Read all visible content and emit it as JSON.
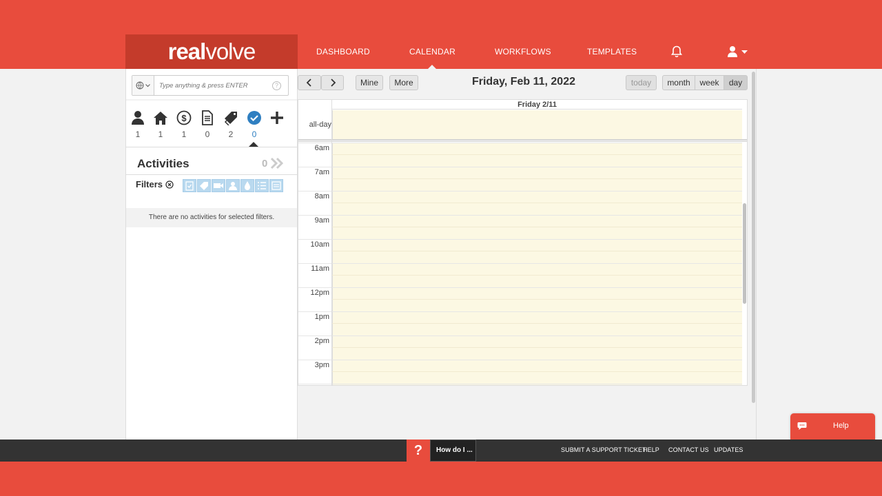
{
  "brand": {
    "logo_bold": "real",
    "logo_light": "volve"
  },
  "nav": {
    "items": [
      {
        "label": "DASHBOARD"
      },
      {
        "label": "CALENDAR",
        "active": true
      },
      {
        "label": "WORKFLOWS"
      },
      {
        "label": "TEMPLATES"
      }
    ]
  },
  "search": {
    "placeholder": "Type anything & press ENTER",
    "help": "?"
  },
  "counters": [
    {
      "icon": "person-icon",
      "count": "1"
    },
    {
      "icon": "house-icon",
      "count": "1"
    },
    {
      "icon": "dollar-icon",
      "count": "1"
    },
    {
      "icon": "document-icon",
      "count": "0"
    },
    {
      "icon": "tags-icon",
      "count": "2"
    },
    {
      "icon": "check-circle-icon",
      "count": "0",
      "selected": true
    }
  ],
  "activities": {
    "title": "Activities",
    "count": "0"
  },
  "filters": {
    "label": "Filters",
    "empty_message": "There are no activities for selected filters."
  },
  "calendar": {
    "prev": "‹",
    "next": "›",
    "mine": "Mine",
    "more": "More",
    "title": "Friday, Feb 11, 2022",
    "today": "today",
    "views": {
      "month": "month",
      "week": "week",
      "day": "day"
    },
    "active_view": "day",
    "column_header": "Friday 2/11",
    "allday_label": "all-day",
    "hours": [
      "6am",
      "7am",
      "8am",
      "9am",
      "10am",
      "11am",
      "12pm",
      "1pm",
      "2pm",
      "3pm"
    ]
  },
  "footer": {
    "howdo_q": "?",
    "howdo_label": "How do I ...",
    "links": [
      "SUBMIT A SUPPORT TICKET",
      "HELP",
      "CONTACT US",
      "UPDATES"
    ]
  },
  "help_widget": {
    "label": "Help"
  },
  "colors": {
    "brand_red": "#e84c3d",
    "logo_bg": "#c43b2b",
    "today_bg": "#fcf8e3",
    "accent_blue": "#2f7fc1",
    "filter_blue": "#b9d9ef"
  }
}
